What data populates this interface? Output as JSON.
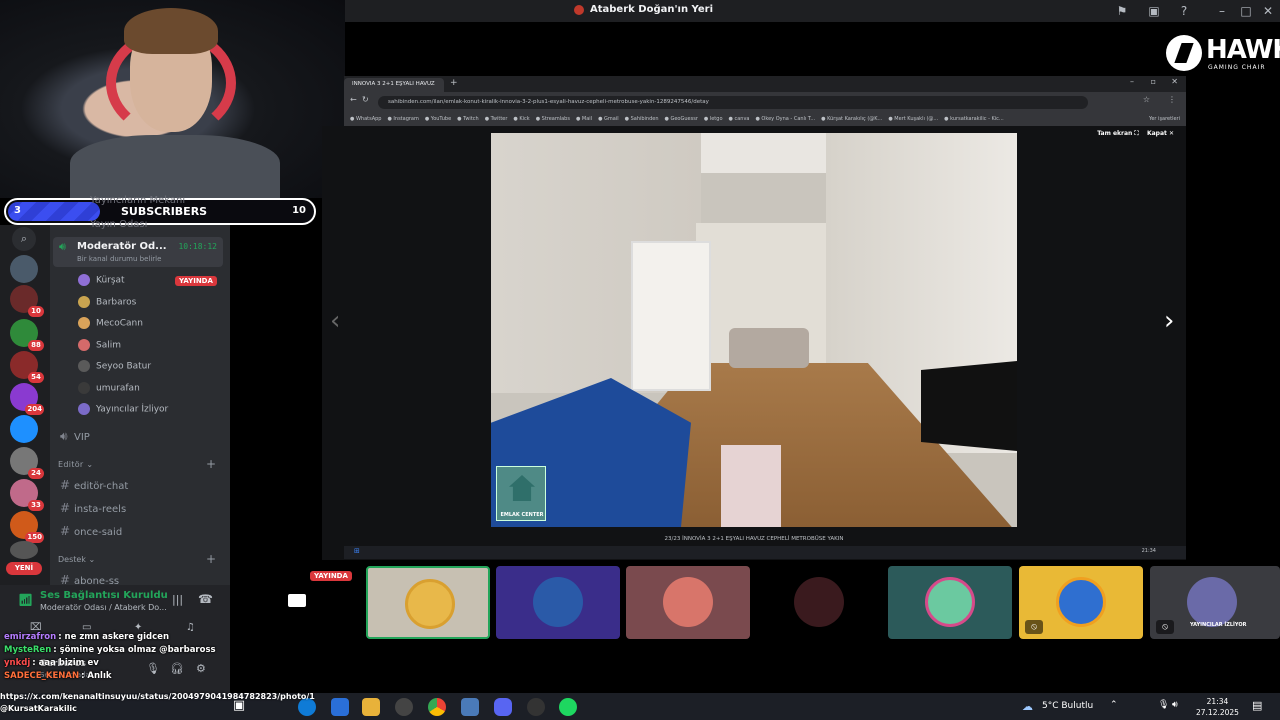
{
  "window": {
    "title": "Ataberk Doğan'ın Yeri"
  },
  "brand": {
    "name": "HAWK",
    "tagline": "GAMING CHAIR"
  },
  "subscribers": {
    "current": "3",
    "label": "SUBSCRIBERS",
    "goal": "10",
    "progress": 0.3
  },
  "servers": {
    "badges": [
      "10",
      "88",
      "54",
      "204",
      "24",
      "33",
      "150"
    ],
    "new_label": "YENİ"
  },
  "channels": {
    "ghost1": "Yayıncıların Mekanı",
    "ghost2": "Yayın Odası",
    "voice_name": "Moderatör Od...",
    "voice_time": "10:18:12",
    "status_placeholder": "Bir kanal durumu belirle",
    "members": [
      {
        "name": "Kürşat",
        "live": "YAYINDA",
        "color": "#8f6fd6"
      },
      {
        "name": "Barbaros",
        "color": "#c9a450"
      },
      {
        "name": "MecoCann",
        "color": "#d9a35a"
      },
      {
        "name": "Salim",
        "color": "#d46a6a"
      },
      {
        "name": "Seyoo Batur",
        "color": "#5a5a5a"
      },
      {
        "name": "umurafan",
        "color": "#3a3a3a"
      },
      {
        "name": "Yayıncılar İzliyor",
        "color": "#7b6bc8"
      }
    ],
    "vip": "VIP",
    "category_editor": "Editör",
    "editor_channels": [
      "editör-chat",
      "insta-reels",
      "once-said"
    ],
    "category_support": "Destek",
    "support_channel": "abone-ss"
  },
  "voice_panel": {
    "status": "Ses Bağlantısı Kuruldu",
    "room": "Moderatör Odası / Ataberk Do...",
    "username": "Barbaros",
    "substatus": "Sesli aramada"
  },
  "chat": [
    {
      "user": "emirzafron",
      "user_color": "#b57cff",
      "msg": "ne zmn askere gidcen"
    },
    {
      "user": "MysteRen",
      "user_color": "#3be06b",
      "msg": "şömine yoksa olmaz @barbaross"
    },
    {
      "user": "ynkdj",
      "user_color": "#ff4d4d",
      "msg": "aaa bizim ev"
    },
    {
      "user": "SADECE_KENAN",
      "user_color": "#ff6f3b",
      "msg": "Anlık"
    }
  ],
  "browser": {
    "tab_title": "INNOVIA 3 2+1 EŞYALI HAVUZ",
    "url": "sahibinden.com/ilan/emlak-konut-kiralik-innovia-3-2-plus1-esyali-havuz-cepheli-metrobuse-yakin-1289247546/detay",
    "bookmarks": [
      "WhatsApp",
      "Instagram",
      "YouTube",
      "Twitch",
      "Twitter",
      "Kick",
      "Streamlabs",
      "Mail",
      "Gmail",
      "Sahibinden",
      "GeoGuessr",
      "letgo",
      "canva",
      "Okey Oyna - Canlı T...",
      "Kürşat Karakılıç (@K...",
      "Mert Kuşaklı (@...",
      "kursatkarakilic - Kic..."
    ],
    "bookmarks_extra": "Yer işaretleri",
    "fullscreen_label": "Tam ekran",
    "close_label": "Kapat",
    "caption": "23/23     İNNOVİA 3 2+1 EŞYALI HAVUZ CEPHELİ METROBÜSE YAKIN",
    "photo_watermark": "EMLAK CENTER",
    "inner_time": "21:34"
  },
  "tiles": {
    "live_label": "YAYINDA",
    "last_label": "YAYINCILAR İZLİYOR"
  },
  "taskbar": {
    "weather": "5°C  Bulutlu",
    "time": "21:34",
    "date": "27.12.2025"
  },
  "status_url": "https://x.com/kenanaltinsuyuu/status/2004979041984782823/photo/1",
  "status_user": "@KursatKarakilic"
}
